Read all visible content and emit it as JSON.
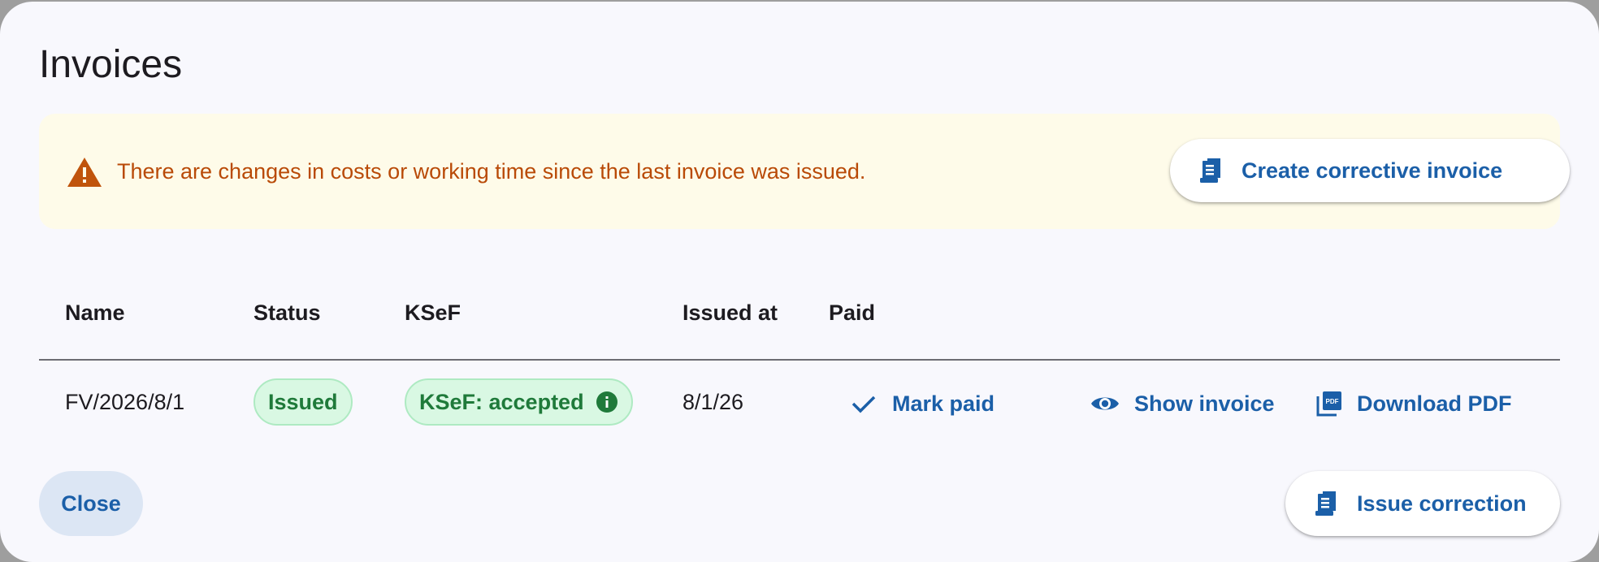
{
  "dialog": {
    "title": "Invoices"
  },
  "banner": {
    "message": "There are changes in costs or working time since the last invoice was issued.",
    "icon": "warning-icon",
    "action_label": "Create corrective invoice",
    "action_icon": "receipt-icon"
  },
  "table": {
    "columns": [
      "Name",
      "Status",
      "KSeF",
      "Issued at",
      "Paid"
    ],
    "rows": [
      {
        "name": "FV/2026/8/1",
        "status": "Issued",
        "ksef": "KSeF: accepted",
        "issued_at": "8/1/26",
        "mark_paid_label": "Mark paid",
        "show_invoice_label": "Show invoice",
        "download_pdf_label": "Download PDF"
      }
    ]
  },
  "footer": {
    "close_label": "Close",
    "issue_correction_label": "Issue correction"
  },
  "colors": {
    "primary": "#1b5fa8",
    "warning_text": "#b94a07",
    "warning_icon": "#c0540c",
    "banner_bg": "#fefbe9",
    "chip_bg": "#d9f8e3",
    "chip_text": "#1f7a3a",
    "dialog_bg": "#f8f8fd",
    "close_bg": "#dce6f4"
  }
}
